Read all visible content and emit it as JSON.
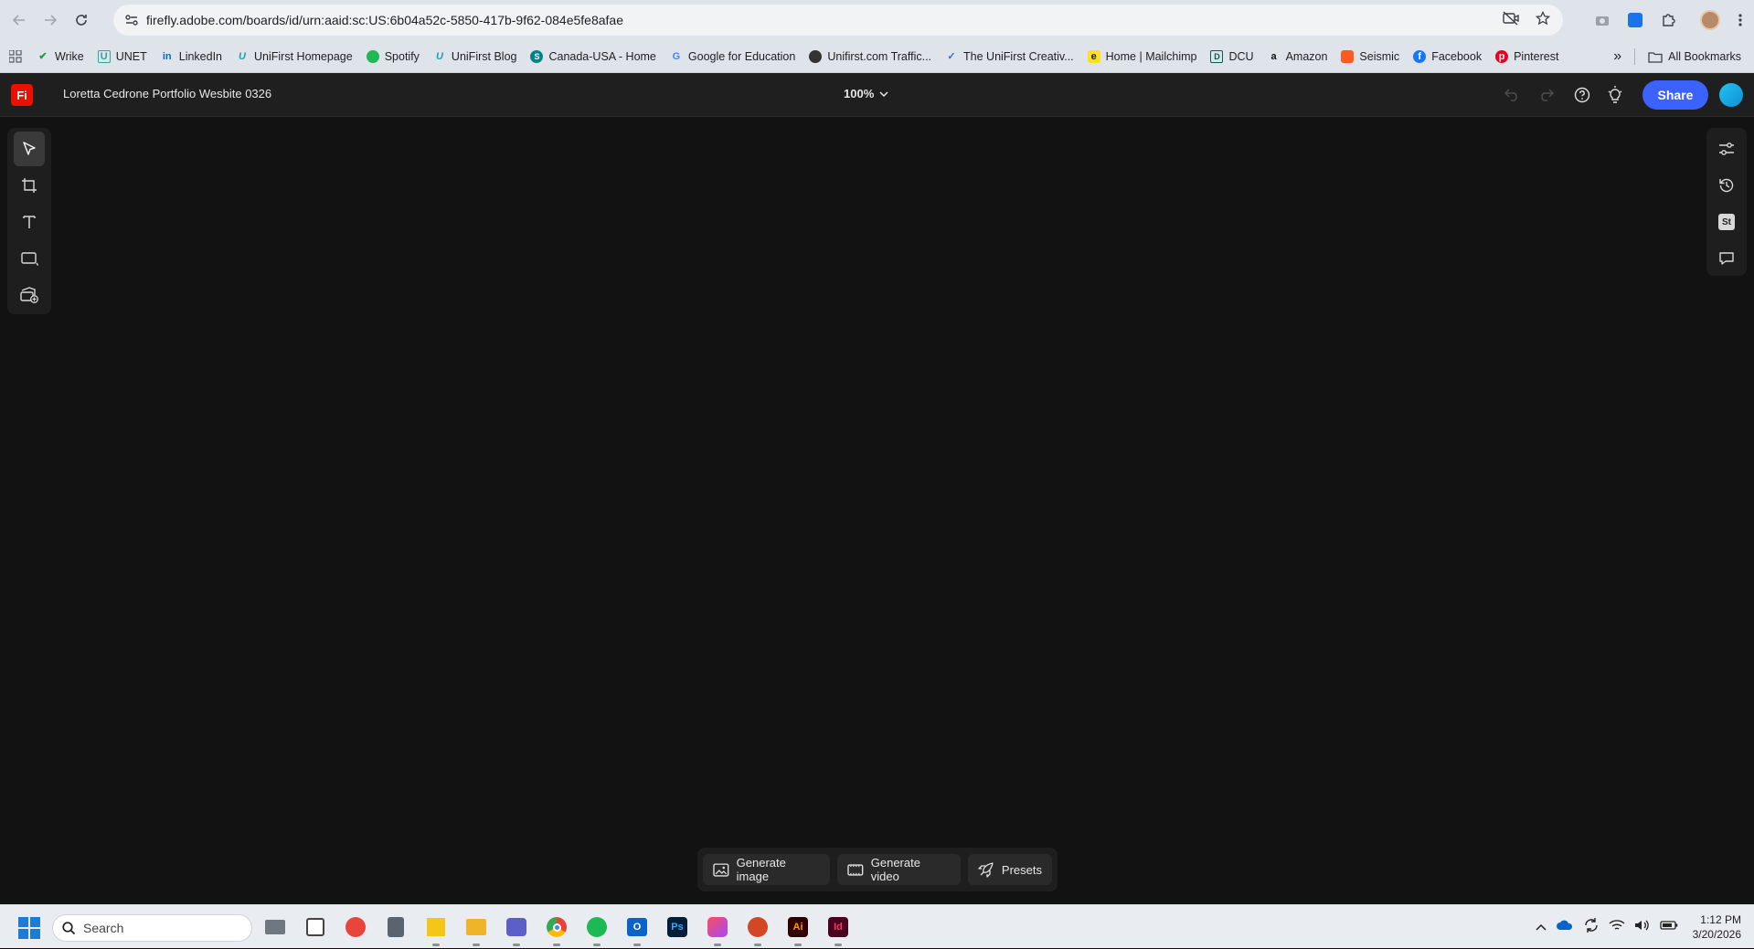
{
  "browser": {
    "url": "firefly.adobe.com/boards/id/urn:aaid:sc:US:6b04a52c-5850-417b-9f62-084e5fe8afae",
    "bookmarks": [
      {
        "label": "Wrike",
        "icon": "wrike-icon",
        "color": "#0fa34a"
      },
      {
        "label": "UNET",
        "icon": "unet-icon",
        "color": "#2aa6a0"
      },
      {
        "label": "LinkedIn",
        "icon": "linkedin-icon",
        "color": "#0a66c2"
      },
      {
        "label": "UniFirst Homepage",
        "icon": "unifirst-icon",
        "color": "#18a3a8"
      },
      {
        "label": "Spotify",
        "icon": "spotify-icon",
        "color": "#1db954"
      },
      {
        "label": "UniFirst Blog",
        "icon": "unifirst-icon",
        "color": "#18a3a8"
      },
      {
        "label": "Canada-USA - Home",
        "icon": "sharepoint-icon",
        "color": "#038387"
      },
      {
        "label": "Google for Education",
        "icon": "google-icon",
        "color": "#4285f4"
      },
      {
        "label": "Unifirst.com Traffic...",
        "icon": "analytics-icon",
        "color": "#e37400"
      },
      {
        "label": "The UniFirst Creativ...",
        "icon": "check-icon",
        "color": "#2f6fd6"
      },
      {
        "label": "Home | Mailchimp",
        "icon": "mailchimp-icon",
        "color": "#ffe01b"
      },
      {
        "label": "DCU",
        "icon": "dcu-icon",
        "color": "#0f5a4a"
      },
      {
        "label": "Amazon",
        "icon": "amazon-icon",
        "color": "#111111"
      },
      {
        "label": "Seismic",
        "icon": "seismic-icon",
        "color": "#ff5a1f"
      },
      {
        "label": "Facebook",
        "icon": "facebook-icon",
        "color": "#1877f2"
      },
      {
        "label": "Pinterest",
        "icon": "pinterest-icon",
        "color": "#e60023"
      }
    ],
    "more_label": "»",
    "all_bookmarks": "All Bookmarks"
  },
  "app": {
    "logo": "Fi",
    "title": "Loretta Cedrone Portfolio Wesbite 0326",
    "zoom": "100%",
    "share_label": "Share",
    "accent": "#3b63fb"
  },
  "generate": {
    "image_label": "Generate image",
    "video_label": "Generate video",
    "presets_label": "Presets"
  },
  "taskbar": {
    "search_placeholder": "Search",
    "time": "1:12 PM",
    "date": "3/20/2026"
  }
}
